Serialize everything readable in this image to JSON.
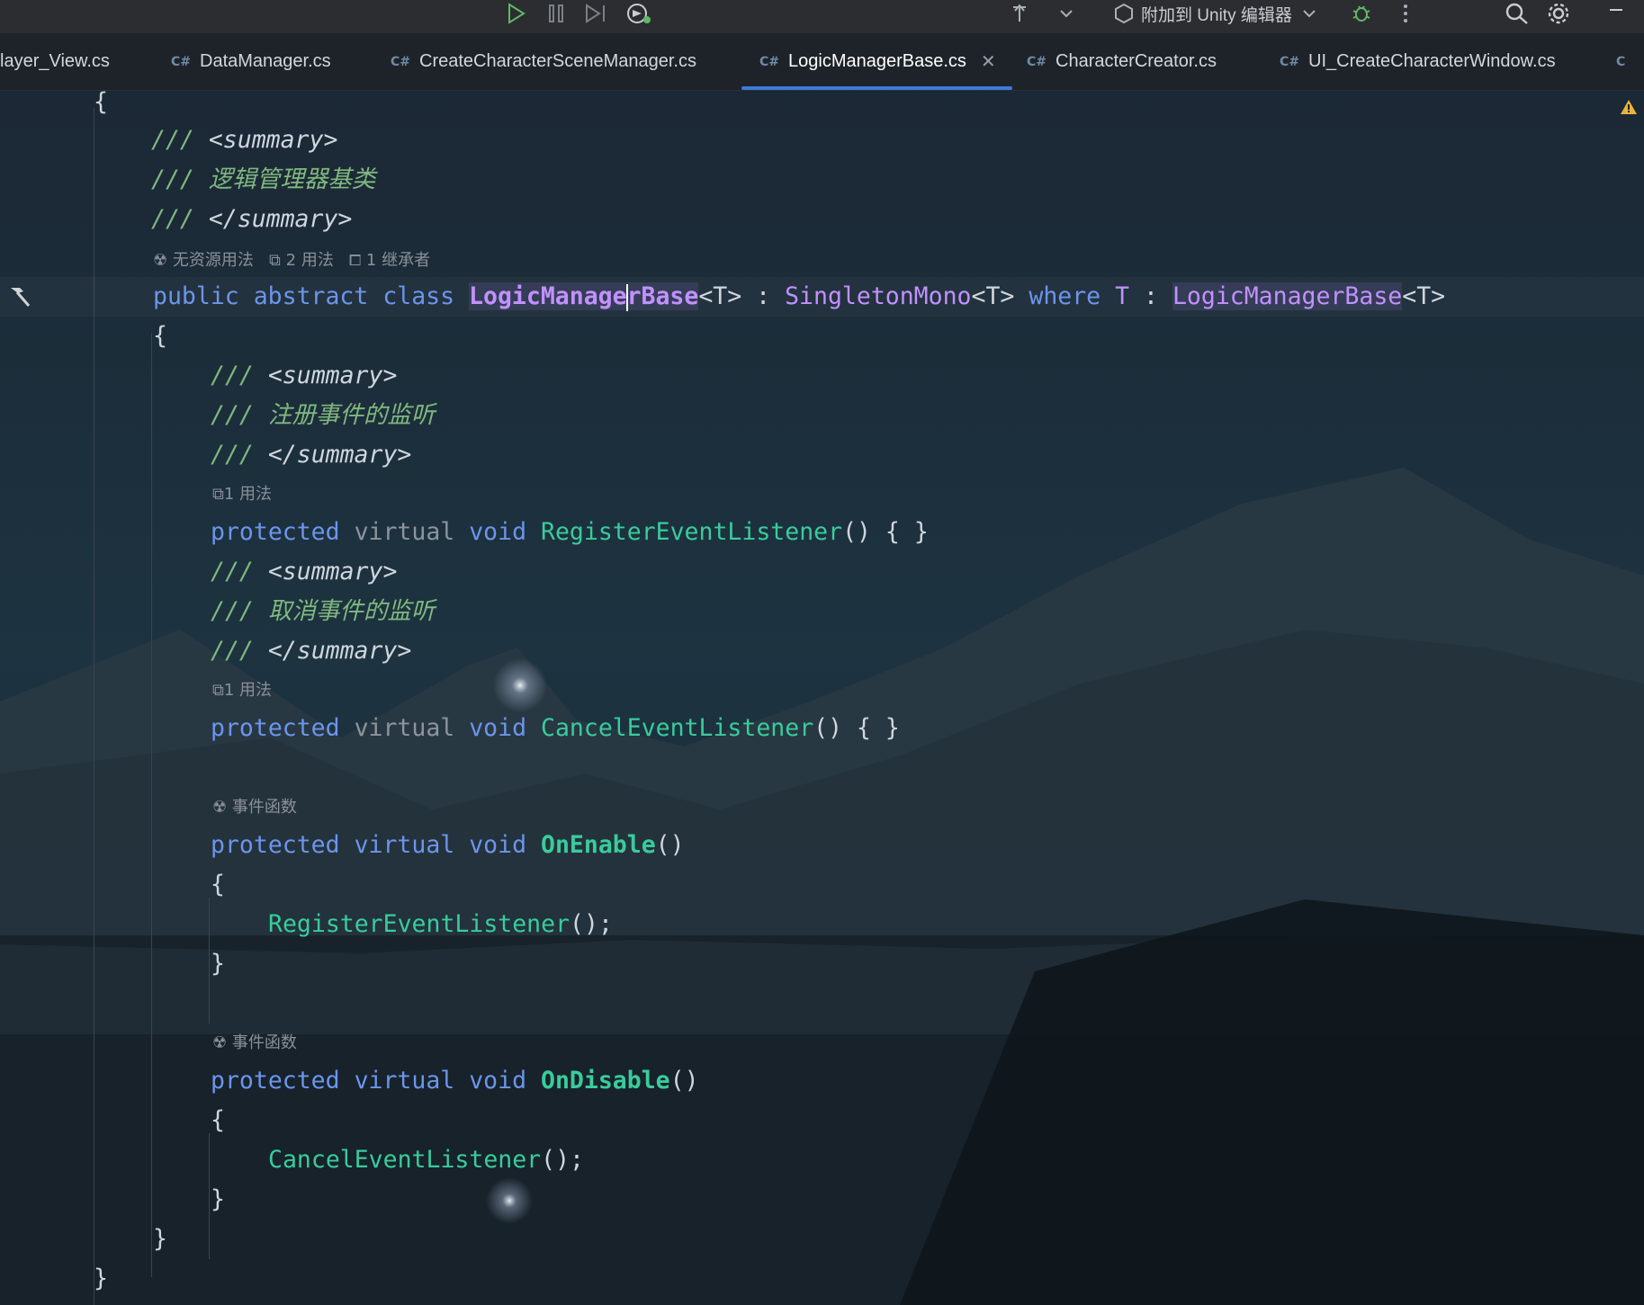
{
  "toolbar": {
    "attach_label": "附加到 Unity 编辑器"
  },
  "tabs": [
    {
      "label": "layer_View.cs"
    },
    {
      "label": "DataManager.cs"
    },
    {
      "label": "CreateCharacterSceneManager.cs"
    },
    {
      "label": "LogicManagerBase.cs"
    },
    {
      "label": "CharacterCreator.cs"
    },
    {
      "label": "UI_CreateCharacterWindow.cs"
    }
  ],
  "code": {
    "open_brace": "{",
    "close_brace": "}",
    "c1_open": "/// ",
    "tag_summary_open": "<summary>",
    "tag_summary_close": "</summary>",
    "c_triple": "/// ",
    "class_comment": "逻辑管理器基类",
    "hint_class": {
      "resources": "无资源用法",
      "usages": "2 用法",
      "inheritors": "1 继承者"
    },
    "kw_public": "public",
    "kw_abstract": "abstract",
    "kw_class": "class",
    "class_name_a": "LogicManage",
    "class_name_b": "rBase",
    "generic_t": "<T>",
    "colon": " : ",
    "base_class": "SingletonMono",
    "kw_where": "where",
    "type_t": "T",
    "constraint": "LogicManagerBase",
    "register_comment": "注册事件的监听",
    "cancel_comment": "取消事件的监听",
    "hint_one_usage": "1 用法",
    "hint_event_func": "事件函数",
    "kw_protected": "protected",
    "kw_virtual": "virtual",
    "kw_void": "void",
    "m_register": "RegisterEventListener",
    "m_cancel": "CancelEventListener",
    "m_onenable": "OnEnable",
    "m_ondisable": "OnDisable",
    "empty_body": "() { }",
    "parens": "()",
    "call_end": "();"
  }
}
